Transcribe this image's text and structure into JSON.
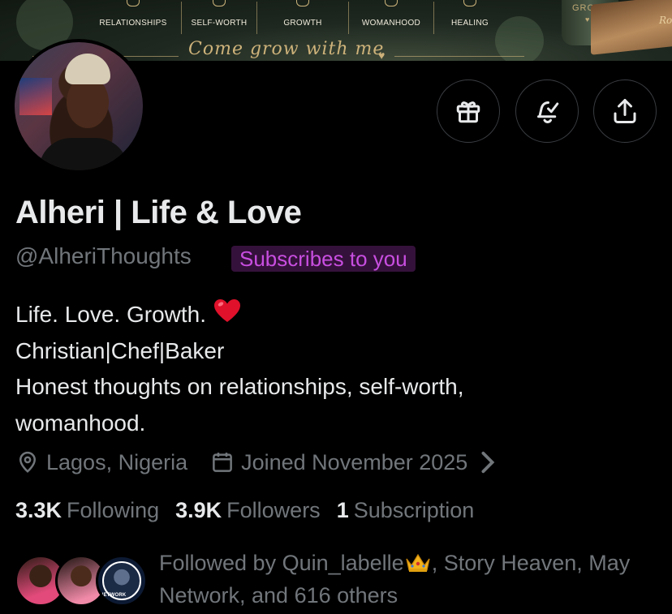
{
  "banner": {
    "tabs": [
      "RELATIONSHIPS",
      "SELF-WORTH",
      "GROWTH",
      "WOMANHOOD",
      "HEALING"
    ],
    "script_text": "Come grow with me",
    "heart": "♥",
    "mug_text": "GROW",
    "book_text": "Ro"
  },
  "profile": {
    "display_name": "Alheri | Life & Love",
    "handle": "@AlheriThoughts",
    "subscription_badge": "Subscribes to you",
    "bio_lines": [
      "Life. Love. Growth.",
      "Christian|Chef|Baker",
      "Honest thoughts on relationships, self-worth,",
      "womanhood."
    ],
    "location": "Lagos, Nigeria",
    "joined": "Joined November 2025"
  },
  "stats": {
    "following_count": "3.3K",
    "following_label": "Following",
    "followers_count": "3.9K",
    "followers_label": "Followers",
    "subscription_count": "1",
    "subscription_label": "Subscription"
  },
  "followed_by": {
    "prefix": "Followed by Quin_labelle",
    "suffix": ", Story Heaven, May",
    "line2": "Network, and 616 others",
    "badge_text": "NETWORK"
  },
  "icons": {
    "actions": [
      "gift-icon",
      "notification-bell-icon",
      "share-icon"
    ],
    "meta": [
      "location-icon",
      "calendar-icon"
    ]
  },
  "colors": {
    "background": "#000000",
    "text_primary": "#e7e9ea",
    "text_secondary": "#71767b",
    "badge_bg": "#34113a",
    "badge_text": "#c84ee0",
    "accent_gold": "#cdb27a"
  }
}
